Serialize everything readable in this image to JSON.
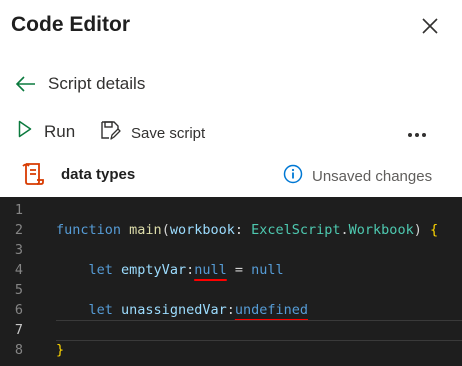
{
  "header": {
    "title": "Code Editor",
    "close_icon": "close-icon"
  },
  "back": {
    "label": "Script details",
    "icon": "arrow-left-icon"
  },
  "toolbar": {
    "run_label": "Run",
    "save_label": "Save script",
    "more_icon": "more-icon"
  },
  "script": {
    "name": "data types",
    "status": "Unsaved changes",
    "icon": "script-file-icon",
    "status_icon": "info-icon"
  },
  "editor": {
    "active_line": 7,
    "lines": [
      {
        "n": "1"
      },
      {
        "n": "2",
        "tokens": [
          {
            "t": "function",
            "c": "kw"
          },
          {
            "t": " ",
            "c": "plain"
          },
          {
            "t": "main",
            "c": "fn"
          },
          {
            "t": "(",
            "c": "plain"
          },
          {
            "t": "workbook",
            "c": "param"
          },
          {
            "t": ": ",
            "c": "plain"
          },
          {
            "t": "ExcelScript",
            "c": "type"
          },
          {
            "t": ".",
            "c": "plain"
          },
          {
            "t": "Workbook",
            "c": "type"
          },
          {
            "t": ") ",
            "c": "plain"
          },
          {
            "t": "{",
            "c": "brace"
          }
        ]
      },
      {
        "n": "3"
      },
      {
        "n": "4",
        "tokens": [
          {
            "t": "    ",
            "c": "plain"
          },
          {
            "t": "let",
            "c": "kw"
          },
          {
            "t": " ",
            "c": "plain"
          },
          {
            "t": "emptyVar",
            "c": "var"
          },
          {
            "t": ":",
            "c": "plain"
          },
          {
            "t": "null",
            "c": "kw err"
          },
          {
            "t": " = ",
            "c": "plain"
          },
          {
            "t": "null",
            "c": "kw"
          }
        ]
      },
      {
        "n": "5"
      },
      {
        "n": "6",
        "tokens": [
          {
            "t": "    ",
            "c": "plain"
          },
          {
            "t": "let",
            "c": "kw"
          },
          {
            "t": " ",
            "c": "plain"
          },
          {
            "t": "unassignedVar",
            "c": "var"
          },
          {
            "t": ":",
            "c": "plain"
          },
          {
            "t": "undefined",
            "c": "kw err"
          }
        ]
      },
      {
        "n": "7"
      },
      {
        "n": "8",
        "tokens": [
          {
            "t": "}",
            "c": "brace"
          }
        ]
      }
    ]
  },
  "colors": {
    "accent": "#0078d4",
    "script_icon": "#d83b01",
    "editor_bg": "#1e1e1e",
    "error_underline": "#ff0000"
  }
}
